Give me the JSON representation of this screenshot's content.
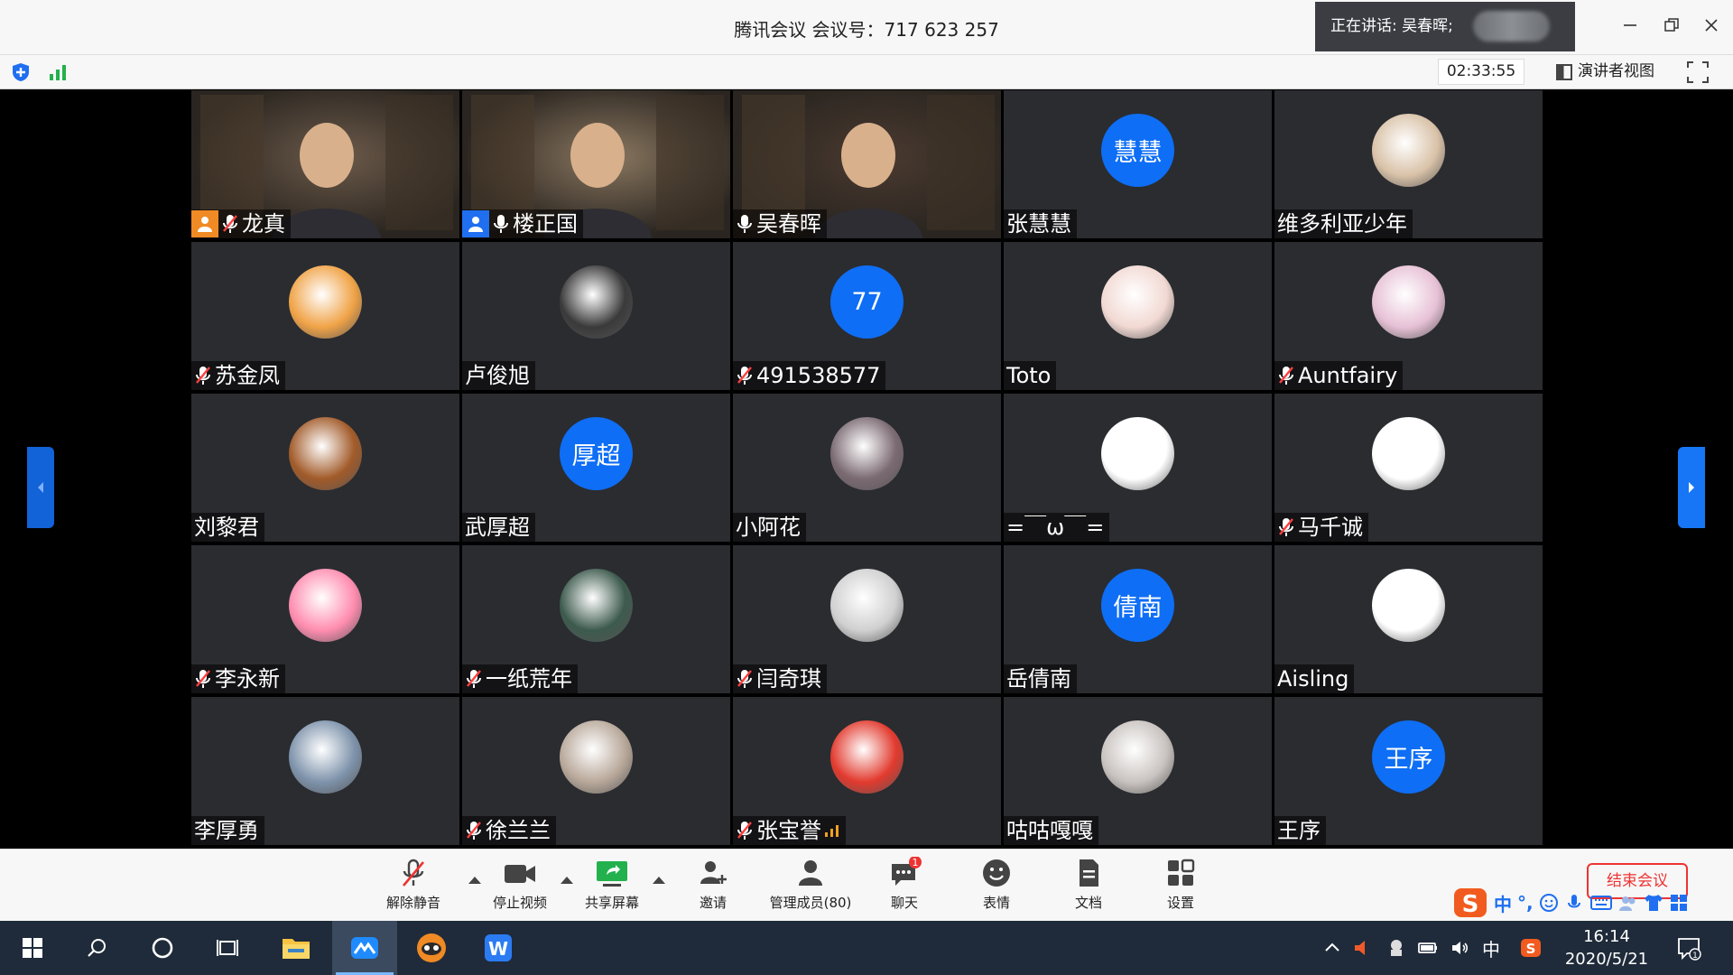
{
  "window": {
    "title": "腾讯会议 会议号：717 623 257",
    "speaking_label": "正在讲话: 吴春晖;",
    "timer": "02:33:55",
    "view_label": "演讲者视图"
  },
  "participants": [
    {
      "name": "龙真",
      "avatar": "video",
      "badge": "host",
      "mic": "muted",
      "color": "#6c5a4a"
    },
    {
      "name": "楼正国",
      "avatar": "video",
      "badge": "cohost",
      "mic": "on",
      "color": "#8a7760"
    },
    {
      "name": "吴春晖",
      "avatar": "video",
      "badge": "none",
      "mic": "on",
      "active": true,
      "color": "#4a3a30"
    },
    {
      "name": "张慧慧",
      "avatar": "text",
      "avatar_text": "慧慧",
      "mic": "none"
    },
    {
      "name": "维多利亚少年",
      "avatar": "image",
      "icon": "cartoon-mouse-avatar",
      "mic": "none",
      "color": "#d9c2a8"
    },
    {
      "name": "苏金凤",
      "avatar": "image",
      "icon": "cartoon-girl-avatar",
      "mic": "muted",
      "color": "#f0a347"
    },
    {
      "name": "卢俊旭",
      "avatar": "image",
      "icon": "giraffe-bw-avatar",
      "mic": "none",
      "color": "#3a3a3a"
    },
    {
      "name": "491538577",
      "avatar": "text",
      "avatar_text": "77",
      "mic": "muted"
    },
    {
      "name": "Toto",
      "avatar": "image",
      "icon": "sketch-girl-avatar",
      "mic": "none",
      "color": "#f2d9d3"
    },
    {
      "name": "Auntfairy",
      "avatar": "image",
      "icon": "anime-girl-avatar",
      "mic": "muted",
      "color": "#e7c1d6"
    },
    {
      "name": "刘黎君",
      "avatar": "image",
      "icon": "sunset-portrait-avatar",
      "mic": "none",
      "color": "#a25b2a"
    },
    {
      "name": "武厚超",
      "avatar": "text",
      "avatar_text": "厚超",
      "mic": "none"
    },
    {
      "name": "小阿花",
      "avatar": "image",
      "icon": "girl-photo-avatar",
      "mic": "none",
      "color": "#7b6a72"
    },
    {
      "name": "=￣ω￣=",
      "avatar": "image",
      "icon": "standing-figure-avatar",
      "mic": "none",
      "color": "#ffffff"
    },
    {
      "name": "马千诚",
      "avatar": "image",
      "icon": "calligraphy-seal-avatar",
      "mic": "muted",
      "color": "#ffffff"
    },
    {
      "name": "李永新",
      "avatar": "image",
      "icon": "cartoon-kid-avatar",
      "mic": "muted",
      "color": "#ff8db0"
    },
    {
      "name": "一纸荒年",
      "avatar": "image",
      "icon": "no-face-avatar",
      "mic": "muted",
      "color": "#3d5a4e"
    },
    {
      "name": "闫奇琪",
      "avatar": "image",
      "icon": "bw-portrait-avatar",
      "mic": "muted",
      "color": "#d0d0d0"
    },
    {
      "name": "岳倩南",
      "avatar": "text",
      "avatar_text": "倩南",
      "mic": "none"
    },
    {
      "name": "Aisling",
      "avatar": "image",
      "icon": "line-drawing-avatar",
      "mic": "none",
      "color": "#ffffff"
    },
    {
      "name": "李厚勇",
      "avatar": "image",
      "icon": "seaside-city-avatar",
      "mic": "none",
      "color": "#7e93ab"
    },
    {
      "name": "徐兰兰",
      "avatar": "image",
      "icon": "doll-avatar",
      "mic": "muted",
      "color": "#b8a89a"
    },
    {
      "name": "张宝誉",
      "avatar": "image",
      "icon": "kid-red-hat-avatar",
      "mic": "muted",
      "signal": true,
      "color": "#e23a2e"
    },
    {
      "name": "咕咕嘎嘎",
      "avatar": "image",
      "icon": "black-cartoon-avatar",
      "mic": "none",
      "color": "#c9c3c0"
    },
    {
      "name": "王序",
      "avatar": "text",
      "avatar_text": "王序",
      "mic": "none"
    }
  ],
  "controls": {
    "unmute": "解除静音",
    "stop_video": "停止视频",
    "share_screen": "共享屏幕",
    "invite": "邀请",
    "manage_members": "管理成员(80)",
    "chat": "聊天",
    "chat_badge": "1",
    "reactions": "表情",
    "documents": "文档",
    "settings": "设置",
    "end_meeting": "结束会议"
  },
  "ime": {
    "mode": "中",
    "punct": "°,"
  },
  "taskbar": {
    "time": "16:14",
    "date": "2020/5/21",
    "ime_lang": "中",
    "notif_count": "1"
  },
  "colors": {
    "accent_blue": "#0e6ef5",
    "host_orange": "#f08a24",
    "active_green": "#2fbf71",
    "end_red": "#e33333"
  }
}
